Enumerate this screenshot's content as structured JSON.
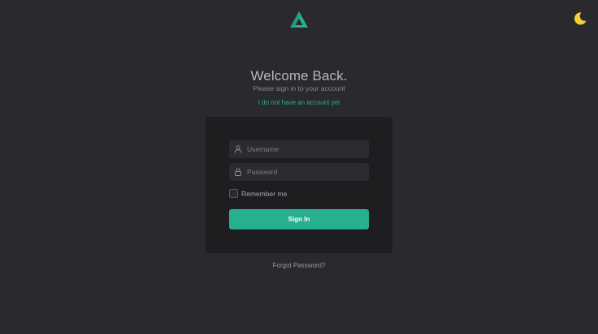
{
  "header": {
    "logo_icon": "triangle-logo-icon",
    "theme_icon": "moon-icon",
    "accent_color": "#27b08f",
    "moon_color": "#f5cf3a"
  },
  "welcome": {
    "title": "Welcome Back.",
    "subtitle": "Please sign in to your account",
    "register_link": "I do not have an account yet"
  },
  "form": {
    "username_placeholder": "Username",
    "password_placeholder": "Password",
    "remember_label": "Remember me",
    "signin_label": "Sign In"
  },
  "footer": {
    "forgot_link": "Forgot Password?"
  }
}
